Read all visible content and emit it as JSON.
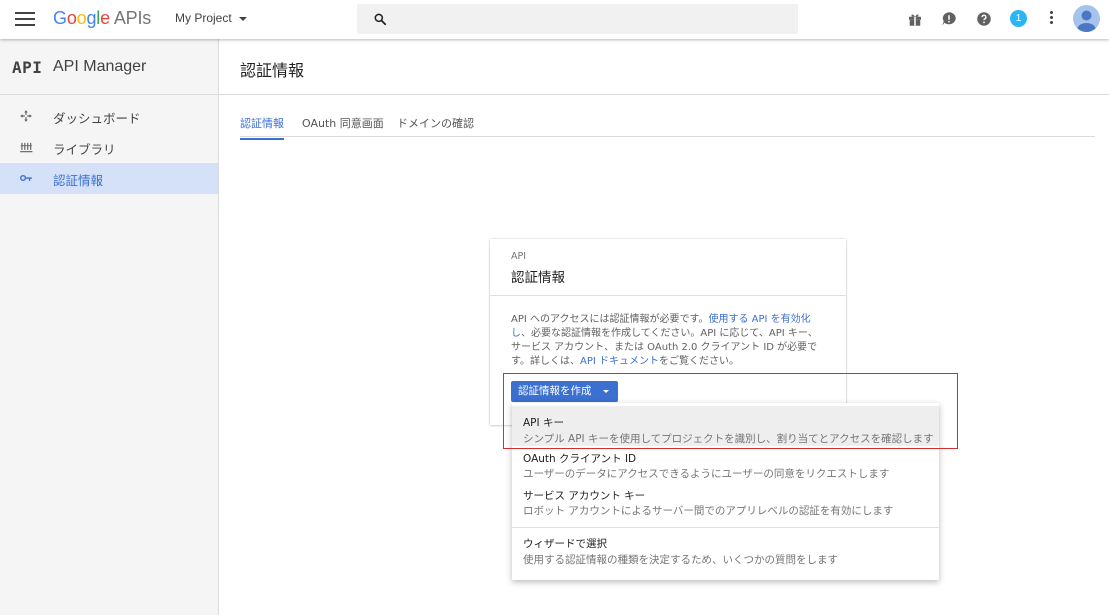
{
  "topbar": {
    "logo_google": [
      "G",
      "o",
      "o",
      "g",
      "l",
      "e"
    ],
    "logo_apis": "APIs",
    "project_name": "My Project",
    "search_placeholder": "",
    "notification_count": "1",
    "icons": [
      "gift-icon",
      "feedback-icon",
      "help-icon",
      "more-vert-icon"
    ]
  },
  "sidebar": {
    "brand_logo": "API",
    "brand_name": "API Manager",
    "items": [
      {
        "label": "ダッシュボード",
        "icon": "dashboard-icon"
      },
      {
        "label": "ライブラリ",
        "icon": "library-icon"
      },
      {
        "label": "認証情報",
        "icon": "key-icon",
        "active": true
      }
    ]
  },
  "page": {
    "title": "認証情報",
    "tabs": [
      {
        "label": "認証情報",
        "active": true
      },
      {
        "label": "OAuth 同意画面"
      },
      {
        "label": "ドメインの確認"
      }
    ]
  },
  "card": {
    "kicker": "API",
    "title": "認証情報",
    "body_1": "API へのアクセスには認証情報が必要です。",
    "body_link1": "使用する API を有効化し",
    "body_2": "、必要な認証情報を作成してください。API に応じて、API キー、サービス アカウント、または OAuth 2.0 クライアント ID が必要です。詳しくは、",
    "body_link2": "API ドキュメント",
    "body_3": "をご覧ください。",
    "create_button": "認証情報を作成"
  },
  "menu": {
    "items": [
      {
        "title": "API キー",
        "desc": "シンプル API キーを使用してプロジェクトを識別し、割り当てとアクセスを確認します"
      },
      {
        "title": "OAuth クライアント ID",
        "desc": "ユーザーのデータにアクセスできるようにユーザーの同意をリクエストします"
      },
      {
        "title": "サービス アカウント キー",
        "desc": "ロボット アカウントによるサーバー間でのアプリレベルの認証を有効にします"
      },
      {
        "title": "ウィザードで選択",
        "desc": "使用する認証情報の種類を決定するため、いくつかの質問をします"
      }
    ]
  },
  "colors": {
    "accent": "#3b6fd0",
    "active_nav_bg": "#d4e1f8",
    "highlight_border": "#d32f2f"
  }
}
